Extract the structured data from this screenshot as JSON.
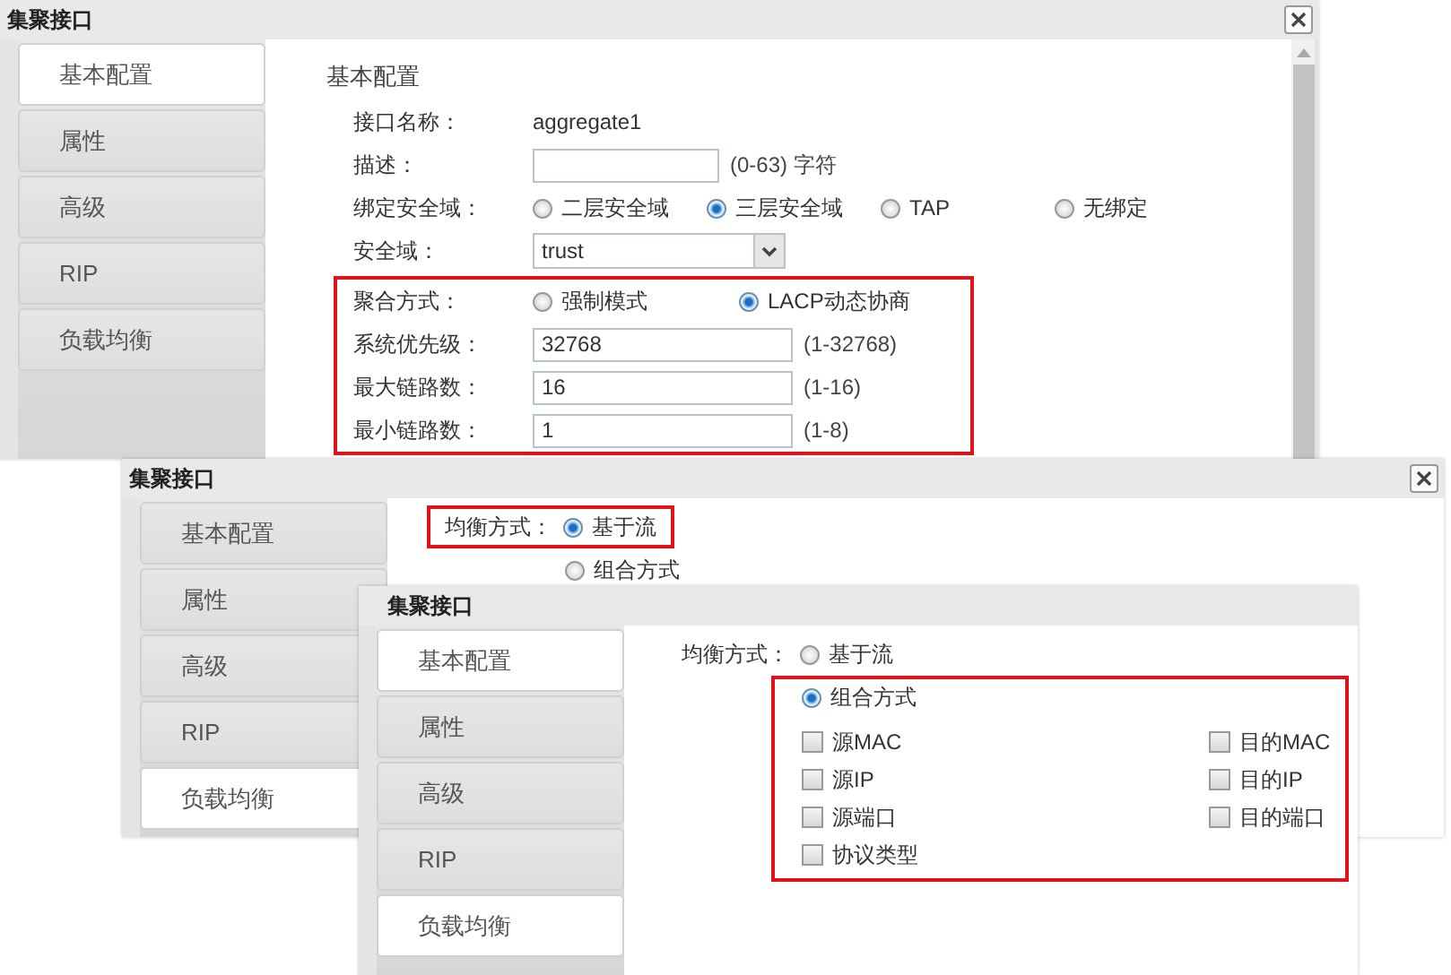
{
  "dialogs": [
    {
      "title": "集聚接口",
      "close_button": true,
      "tabs": [
        {
          "label": "基本配置",
          "selected": true
        },
        {
          "label": "属性",
          "selected": false
        },
        {
          "label": "高级",
          "selected": false
        },
        {
          "label": "RIP",
          "selected": false
        },
        {
          "label": "负载均衡",
          "selected": false
        }
      ],
      "content": {
        "kind": "basic",
        "heading": "基本配置",
        "groups": [
          {
            "highlighted": false,
            "rows": [
              {
                "kind": "text",
                "label": "接口名称：",
                "value": "aggregate1"
              },
              {
                "kind": "input",
                "label": "描述：",
                "hint": "(0-63) 字符"
              },
              {
                "kind": "radio",
                "label": "绑定安全域：",
                "options": [
                  {
                    "label": "二层安全域",
                    "selected": false
                  },
                  {
                    "label": "三层安全域",
                    "selected": true
                  },
                  {
                    "label": "TAP",
                    "selected": false
                  },
                  {
                    "label": "无绑定",
                    "selected": false
                  }
                ]
              },
              {
                "kind": "select",
                "label": "安全域：",
                "value": "trust"
              }
            ]
          },
          {
            "highlighted": true,
            "rows": [
              {
                "kind": "radio",
                "label": "聚合方式：",
                "options": [
                  {
                    "label": "强制模式",
                    "selected": false
                  },
                  {
                    "label": "LACP动态协商",
                    "selected": true
                  }
                ]
              },
              {
                "kind": "input",
                "label": "系统优先级：",
                "value": "32768",
                "hint": "(1-32768)"
              },
              {
                "kind": "input",
                "label": "最大链路数：",
                "value": "16",
                "hint": "(1-16)"
              },
              {
                "kind": "input",
                "label": "最小链路数：",
                "value": "1",
                "hint": "(1-8)"
              }
            ]
          }
        ]
      }
    },
    {
      "title": "集聚接口",
      "close_button": true,
      "tabs": [
        {
          "label": "基本配置",
          "selected": false
        },
        {
          "label": "属性",
          "selected": false
        },
        {
          "label": "高级",
          "selected": false
        },
        {
          "label": "RIP",
          "selected": false
        },
        {
          "label": "负载均衡",
          "selected": true
        }
      ],
      "content": {
        "kind": "balance",
        "groups": [
          {
            "highlighted": true,
            "label": "均衡方式：",
            "option": {
              "label": "基于流",
              "selected": true
            }
          },
          {
            "highlighted": false,
            "option": {
              "label": "组合方式",
              "selected": false
            }
          }
        ]
      }
    },
    {
      "title": "集聚接口",
      "close_button": false,
      "tabs": [
        {
          "label": "基本配置",
          "selected": true
        },
        {
          "label": "属性",
          "selected": false
        },
        {
          "label": "高级",
          "selected": false
        },
        {
          "label": "RIP",
          "selected": false
        },
        {
          "label": "负载均衡",
          "selected": true
        }
      ],
      "content": {
        "kind": "balance",
        "groups": [
          {
            "highlighted": false,
            "label": "均衡方式：",
            "option": {
              "label": "基于流",
              "selected": false
            }
          },
          {
            "highlighted": true,
            "option": {
              "label": "组合方式",
              "selected": true
            },
            "checkboxes": [
              {
                "label": "源MAC",
                "checked": false
              },
              {
                "label": "目的MAC",
                "checked": false
              },
              {
                "label": "源IP",
                "checked": false
              },
              {
                "label": "目的IP",
                "checked": false
              },
              {
                "label": "源端口",
                "checked": false
              },
              {
                "label": "目的端口",
                "checked": false
              },
              {
                "label": "协议类型",
                "checked": false
              }
            ]
          }
        ]
      }
    }
  ]
}
